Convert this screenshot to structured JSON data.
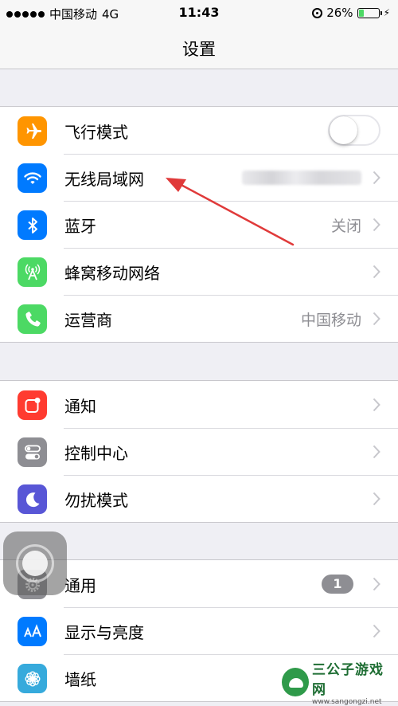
{
  "status_bar": {
    "carrier": "中国移动",
    "network": "4G",
    "time": "11:43",
    "battery": "26%",
    "battery_level": 0.26
  },
  "nav": {
    "title": "设置"
  },
  "groups": [
    {
      "items": [
        {
          "label": "飞行模式",
          "icon": "airplane-icon",
          "icon_color": "#ff9500",
          "control": "toggle",
          "toggle_on": false
        },
        {
          "label": "无线局域网",
          "icon": "wifi-icon",
          "icon_color": "#007aff",
          "value_obscured": true
        },
        {
          "label": "蓝牙",
          "icon": "bluetooth-icon",
          "icon_color": "#007aff",
          "value": "关闭"
        },
        {
          "label": "蜂窝移动网络",
          "icon": "cellular-antenna-icon",
          "icon_color": "#4cd964"
        },
        {
          "label": "运营商",
          "icon": "phone-icon",
          "icon_color": "#4cd964",
          "value": "中国移动"
        }
      ]
    },
    {
      "items": [
        {
          "label": "通知",
          "icon": "notifications-icon",
          "icon_color": "#ff3b30"
        },
        {
          "label": "控制中心",
          "icon": "control-center-icon",
          "icon_color": "#8e8e93"
        },
        {
          "label": "勿扰模式",
          "icon": "moon-icon",
          "icon_color": "#5856d6"
        }
      ]
    },
    {
      "items": [
        {
          "label": "通用",
          "icon": "gear-icon",
          "icon_color": "#8e8e93",
          "badge": "1"
        },
        {
          "label": "显示与亮度",
          "icon": "display-aa-icon",
          "icon_color": "#007aff"
        },
        {
          "label": "墙纸",
          "icon": "wallpaper-flower-icon",
          "icon_color": "#36aadc"
        }
      ]
    }
  ],
  "annotation": {
    "arrow_color": "#e03a3a"
  },
  "watermark": {
    "title": "三公子游戏网",
    "url": "www.sangongzi.net"
  }
}
